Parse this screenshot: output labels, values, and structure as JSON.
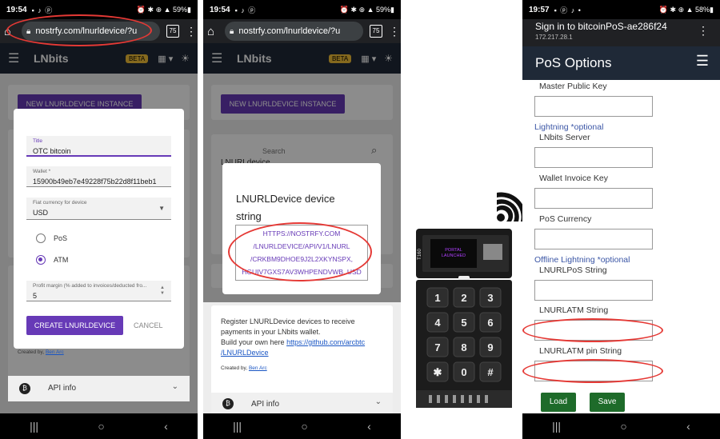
{
  "screen1": {
    "status": {
      "time": "19:54",
      "left_icons": "▪ ♪ ⓟ",
      "right": "⏰ ✱ ⊕ ▲ 59%▮"
    },
    "url": "nostrfy.com/lnurldevice/?u",
    "tabs_count": "75",
    "app": {
      "title": "LNbits",
      "beta": "BETA"
    },
    "new_button": "NEW LNURLDEVICE INSTANCE",
    "dialog": {
      "title_label": "Title",
      "title_value": "OTC bitcoin",
      "wallet_label": "Wallet *",
      "wallet_value": "15900b49eb7e49228f75b22d8f11beb1",
      "currency_label": "Fiat currency for device",
      "currency_value": "USD",
      "radio_pos": "PoS",
      "radio_atm": "ATM",
      "margin_label": "Profit margin (% added to invoices/deducted fro...",
      "margin_value": "5",
      "create_button": "CREATE LNURLDEVICE",
      "cancel_button": "CANCEL"
    },
    "created_by": "Created by,",
    "author": "Ben Arc",
    "api_info": "API info"
  },
  "screen2": {
    "status": {
      "time": "19:54",
      "left_icons": "▪ ♪ ⓟ",
      "right": "⏰ ✱ ⊕ ▲ 59%▮"
    },
    "url": "nostrfy.com/lnurldevice/?u",
    "tabs_count": "75",
    "app": {
      "title": "LNbits",
      "beta": "BETA"
    },
    "new_button": "NEW LNURLDEVICE INSTANCE",
    "search_placeholder": "Search",
    "list_title": "LNURLdevice",
    "dialog": {
      "title_line1": "LNURLDevice device",
      "title_line2": "string",
      "string_lines": [
        "HTTPS://NOSTRFY.COM",
        "/LNURLDEVICE/API/V1/LNURL",
        "/CRKBM9DHOE9J2L2XKYNSPX,",
        "HGUIV7GXS7AV3WHPENDVWB, USD"
      ]
    },
    "register_text_1": "Register LNURLDevice devices to receive",
    "register_text_2": "payments in your LNbits wallet.",
    "build_text": "Build your own here",
    "build_link_1": "https://github.com/arcbtc",
    "build_link_2": "/LNURLDevice",
    "created_by": "Created by,",
    "author": "Ben Arc",
    "api_info": "API info"
  },
  "screen3": {
    "screen_text_1": "PORTAL",
    "screen_text_2": "LAUNCHED",
    "board_label": "T160",
    "keys": [
      "1",
      "2",
      "3",
      "4",
      "5",
      "6",
      "7",
      "8",
      "9",
      "✱",
      "0",
      "#"
    ]
  },
  "screen4": {
    "status": {
      "time": "19:57",
      "left_icons": "▪ ⓟ ♪ •",
      "right": "⏰ ✱ ⊕ ▲ 58%▮"
    },
    "signin_title": "Sign in to bitcoinPoS-ae286f24",
    "signin_ip": "172.217.28.1",
    "header_title": "PoS Options",
    "fields": {
      "master_public_key": "Master Public Key",
      "lightning_section": "Lightning *optional",
      "lnbits_server": "LNbits Server",
      "wallet_invoice_key": "Wallet Invoice Key",
      "pos_currency": "PoS Currency",
      "offline_section": "Offline Lightning *optional",
      "lnurlpos_string": "LNURLPoS String",
      "lnurlatm_string": "LNURLATM String",
      "lnurlatm_pin": "LNURLATM pin String"
    },
    "load_button": "Load",
    "save_button": "Save"
  },
  "colors": {
    "accent_purple": "#673ab7",
    "header_dark": "#1f2937",
    "annotation_red": "#e53935",
    "button_green": "#1e6b2a",
    "section_blue": "#3a55a5"
  }
}
